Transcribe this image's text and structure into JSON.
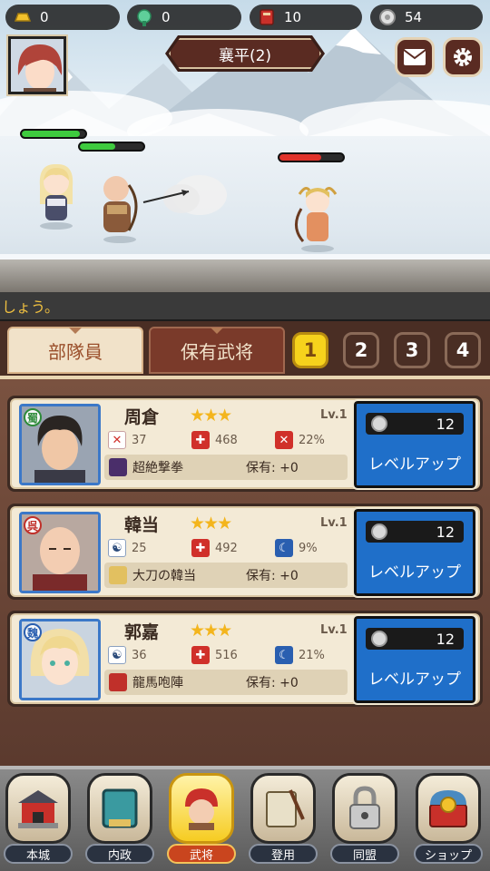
{
  "resources": [
    {
      "name": "gold",
      "icon": "gold-ingot-icon",
      "value": "0"
    },
    {
      "name": "gem",
      "icon": "green-gem-icon",
      "value": "0"
    },
    {
      "name": "scroll",
      "icon": "red-scroll-icon",
      "value": "10"
    },
    {
      "name": "silver",
      "icon": "silver-coin-icon",
      "value": "54"
    }
  ],
  "stage": {
    "title": "襄平(2)"
  },
  "header_buttons": {
    "mail_icon": "mail-icon",
    "settings_icon": "gear-icon"
  },
  "ticker": {
    "text": "しょう。"
  },
  "tabs": [
    {
      "label": "部隊員",
      "active": true
    },
    {
      "label": "保有武将",
      "active": false
    }
  ],
  "pages": [
    "1",
    "2",
    "3",
    "4"
  ],
  "active_page": "1",
  "heroes": [
    {
      "name": "周倉",
      "faction": "蜀",
      "faction_color": "#2e8b3a",
      "stars": "★★★",
      "level": "Lv.1",
      "stats": [
        {
          "icon": "sword-icon",
          "value": "37"
        },
        {
          "icon": "hp-cross-icon",
          "value": "468"
        },
        {
          "icon": "crit-icon",
          "value": "22%"
        }
      ],
      "skill": "超絶撃拳",
      "owned": "保有: +0",
      "cost": "12",
      "button_label": "レベルアップ"
    },
    {
      "name": "韓当",
      "faction": "呉",
      "faction_color": "#c0302a",
      "stars": "★★★",
      "level": "Lv.1",
      "stats": [
        {
          "icon": "yin-yang-icon",
          "value": "25"
        },
        {
          "icon": "hp-cross-icon",
          "value": "492"
        },
        {
          "icon": "crescent-icon",
          "value": "9%"
        }
      ],
      "skill": "大刀の韓当",
      "owned": "保有: +0",
      "cost": "12",
      "button_label": "レベルアップ"
    },
    {
      "name": "郭嘉",
      "faction": "魏",
      "faction_color": "#2a5fb0",
      "stars": "★★★",
      "level": "Lv.1",
      "stats": [
        {
          "icon": "yin-yang-icon",
          "value": "36"
        },
        {
          "icon": "hp-cross-icon",
          "value": "516"
        },
        {
          "icon": "crescent-icon",
          "value": "21%"
        }
      ],
      "skill": "龍馬咆陣",
      "owned": "保有: +0",
      "cost": "12",
      "button_label": "レベルアップ"
    }
  ],
  "nav": [
    {
      "label": "本城",
      "icon": "castle-icon",
      "active": false
    },
    {
      "label": "内政",
      "icon": "book-icon",
      "active": false
    },
    {
      "label": "武将",
      "icon": "general-helmet-icon",
      "active": true
    },
    {
      "label": "登用",
      "icon": "recruit-scroll-icon",
      "active": false
    },
    {
      "label": "同盟",
      "icon": "lock-icon",
      "active": false
    },
    {
      "label": "ショップ",
      "icon": "treasure-chest-icon",
      "active": false
    }
  ],
  "colors": {
    "accent_gold": "#f6d21c",
    "panel_brown": "#5b3a2e",
    "levelup_blue": "#1f6fc9",
    "hp_green": "#3ecb3e",
    "hp_red": "#e0322a"
  }
}
